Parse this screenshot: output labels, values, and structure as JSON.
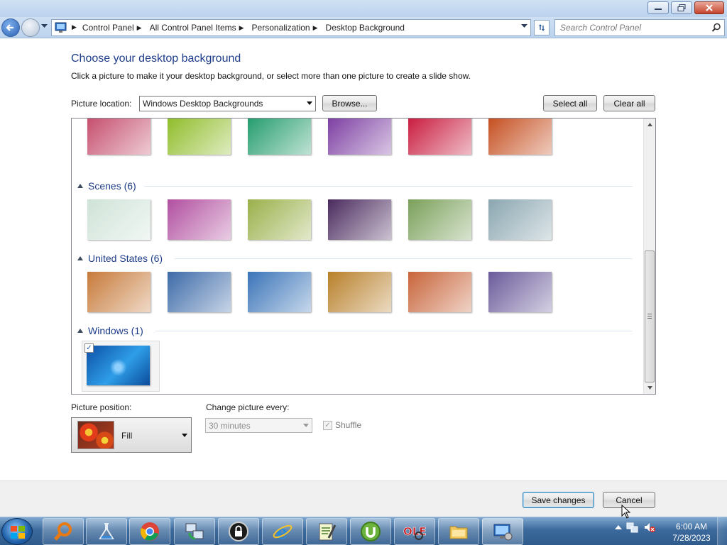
{
  "window": {
    "controls": [
      "minimize",
      "restore",
      "close"
    ]
  },
  "nav": {
    "breadcrumbs": [
      "Control Panel",
      "All Control Panel Items",
      "Personalization",
      "Desktop Background"
    ],
    "search_placeholder": "Search Control Panel"
  },
  "page": {
    "heading": "Choose your desktop background",
    "subtext": "Click a picture to make it your desktop background, or select more than one picture to create a slide show."
  },
  "location": {
    "label": "Picture location:",
    "selected": "Windows Desktop Backgrounds",
    "browse_label": "Browse...",
    "select_all_label": "Select all",
    "clear_all_label": "Clear all"
  },
  "groups": [
    {
      "title": "",
      "thumbnails": [
        "#c44a6a",
        "#8dbb24",
        "#1f9a6a",
        "#7a3aa0",
        "#c8163a",
        "#c44a1a"
      ]
    },
    {
      "title": "Scenes (6)",
      "thumbnails": [
        "#cfe3d8",
        "#b14fa0",
        "#9ab04a",
        "#4a2a5e",
        "#7aa05a",
        "#8aa6b0"
      ]
    },
    {
      "title": "United States (6)",
      "thumbnails": [
        "#c77a3a",
        "#3c6aa8",
        "#3a74b8",
        "#b8802a",
        "#c8643a",
        "#6a5a9a"
      ]
    },
    {
      "title": "Windows (1)",
      "thumbnails": [
        "#1c77d0"
      ],
      "selected": true
    }
  ],
  "options": {
    "position_label": "Picture position:",
    "position_value": "Fill",
    "interval_label": "Change picture every:",
    "interval_value": "30 minutes",
    "shuffle_label": "Shuffle",
    "shuffle_checked": true
  },
  "footer": {
    "save_label": "Save changes",
    "cancel_label": "Cancel"
  },
  "taskbar": {
    "items": [
      "search-app",
      "app-2",
      "chrome",
      "network-app",
      "lock-app",
      "internet-explorer",
      "editor-app",
      "utorrent",
      "ole-app",
      "file-explorer",
      "control-panel"
    ],
    "time": "6:00 AM",
    "date": "7/28/2023"
  },
  "colors": {
    "heading": "#1e3d8a",
    "accent": "#3c6aa8"
  }
}
